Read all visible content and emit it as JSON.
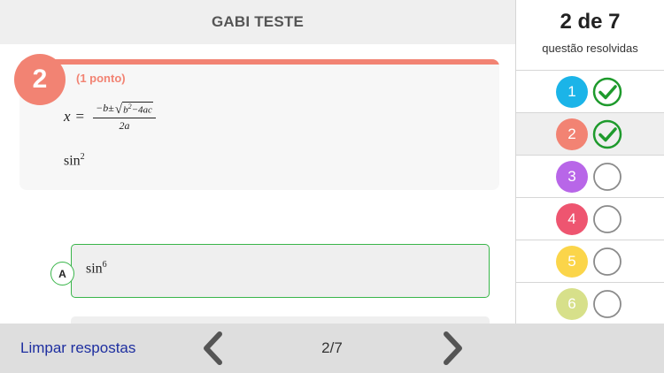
{
  "header": {
    "title": "GABI TESTE"
  },
  "question": {
    "number": "2",
    "points": "(1 ponto)",
    "formula": {
      "lhs": "x",
      "equals": "=",
      "numerator_prefix": "−b±",
      "sqrt_b": "b",
      "sqrt_exp": "2",
      "sqrt_rest": "−4ac",
      "denominator": "2a"
    },
    "expression": {
      "base": "sin",
      "exp": "2"
    }
  },
  "options": [
    {
      "letter": "A",
      "base": "sin",
      "exp": "6",
      "border_color": "#39b54a"
    }
  ],
  "sidebar": {
    "progress_count": "2 de 7",
    "progress_label": "questão resolvidas",
    "items": [
      {
        "number": "1",
        "color": "#1bb4e8",
        "answered": true
      },
      {
        "number": "2",
        "color": "#f28373",
        "answered": true,
        "selected": true
      },
      {
        "number": "3",
        "color": "#b866e8",
        "answered": false
      },
      {
        "number": "4",
        "color": "#ee5570",
        "answered": false
      },
      {
        "number": "5",
        "color": "#fbd54a",
        "answered": false
      },
      {
        "number": "6",
        "color": "#d7e08a",
        "answered": false
      }
    ]
  },
  "footer": {
    "clear_label": "Limpar respostas",
    "page_indicator": "2/7",
    "prev_icon": "chevron-left-icon",
    "next_icon": "chevron-right-icon"
  },
  "colors": {
    "accent": "#f28373",
    "check_green": "#1e9a2c",
    "link_blue": "#1e2fa0"
  }
}
